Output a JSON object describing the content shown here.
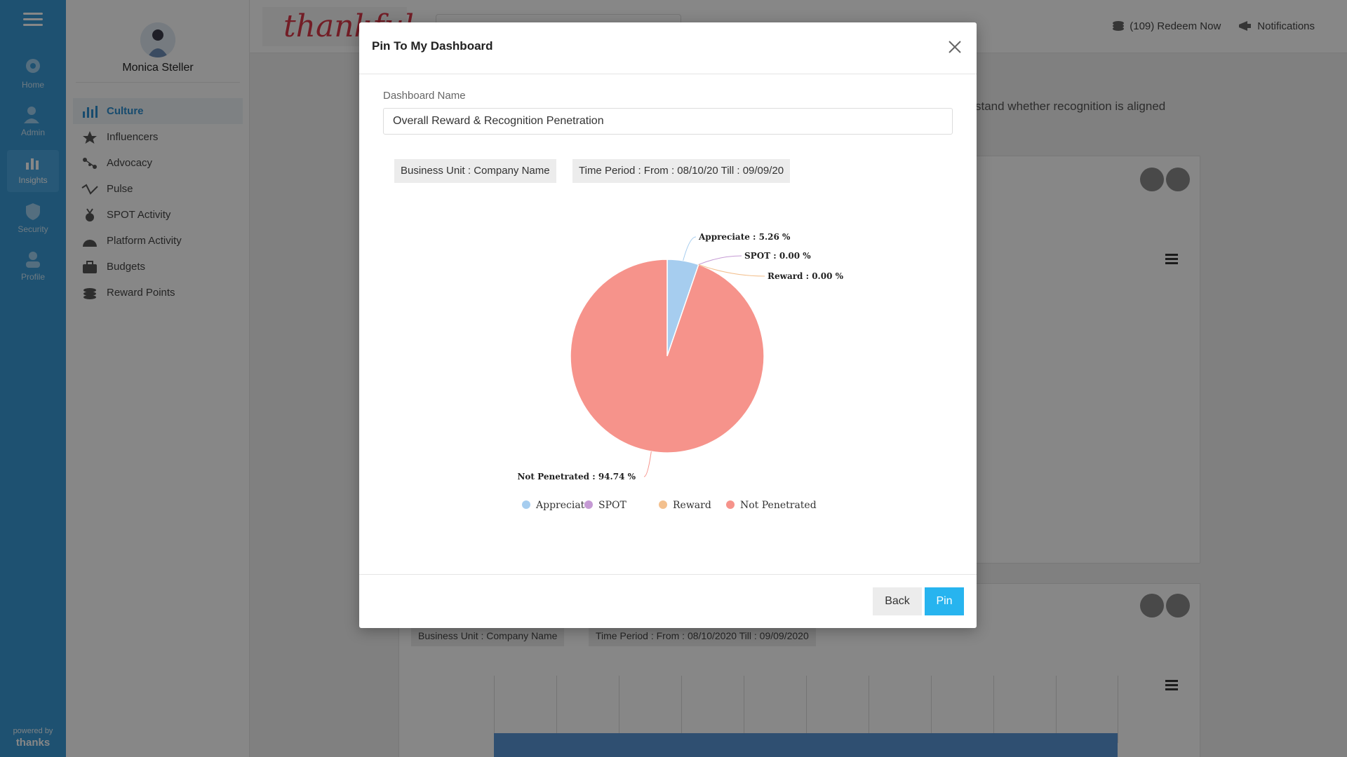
{
  "sidebar_rail": {
    "items": [
      {
        "label": "Home",
        "icon": "home-gear-icon"
      },
      {
        "label": "Admin",
        "icon": "admin-user-icon"
      },
      {
        "label": "Insights",
        "icon": "bar-chart-icon"
      },
      {
        "label": "Security",
        "icon": "shield-check-icon"
      },
      {
        "label": "Profile",
        "icon": "user-icon"
      }
    ],
    "powered_by": "powered by",
    "brand": "thanks"
  },
  "user": {
    "name": "Monica Steller"
  },
  "nav": {
    "items": [
      {
        "label": "Culture",
        "icon": "bar-chart-icon"
      },
      {
        "label": "Influencers",
        "icon": "star-icon"
      },
      {
        "label": "Advocacy",
        "icon": "network-icon"
      },
      {
        "label": "Pulse",
        "icon": "pulse-icon"
      },
      {
        "label": "SPOT Activity",
        "icon": "medal-icon"
      },
      {
        "label": "Platform Activity",
        "icon": "gauge-icon"
      },
      {
        "label": "Budgets",
        "icon": "briefcase-icon"
      },
      {
        "label": "Reward Points",
        "icon": "coins-icon"
      }
    ]
  },
  "header": {
    "logo_text": "thankful",
    "redeem": "(109) Redeem Now",
    "notifications": "Notifications"
  },
  "background": {
    "text": "stand whether recognition is aligned",
    "chip_bu": "Business Unit : Company Name",
    "chip_period": "Time Period : From : 08/10/2020 Till : 09/09/2020"
  },
  "modal": {
    "title": "Pin To My Dashboard",
    "field_label": "Dashboard Name",
    "field_value": "Overall Reward & Recognition Penetration",
    "chip_bu": "Business Unit : Company Name",
    "chip_period": "Time Period : From : 08/10/20 Till : 09/09/20",
    "back_label": "Back",
    "pin_label": "Pin"
  },
  "chart_data": {
    "type": "pie",
    "categories": [
      "Appreciate",
      "SPOT",
      "Reward",
      "Not Penetrated"
    ],
    "values": [
      5.26,
      0.0,
      0.0,
      94.74
    ],
    "labels": [
      "Appreciate : 5.26 %",
      "SPOT : 0.00 %",
      "Reward : 0.00 %",
      "Not Penetrated : 94.74 %"
    ],
    "colors": [
      "#a6cdef",
      "#c59ad4",
      "#f3c08e",
      "#f6938b"
    ],
    "legend_position": "bottom"
  }
}
